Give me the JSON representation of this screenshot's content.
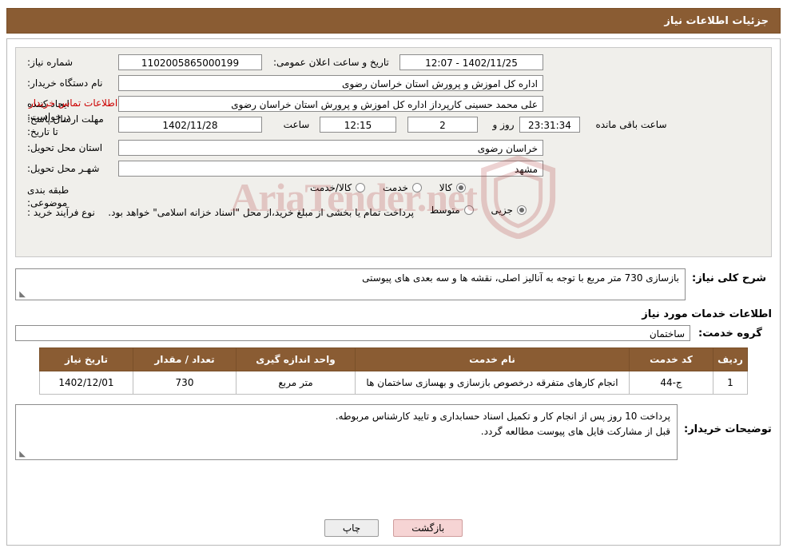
{
  "header": {
    "title": "جزئیات اطلاعات نیاز"
  },
  "info": {
    "need_number_label": "شماره نیاز:",
    "need_number_value": "1102005865000199",
    "public_announce_label": "تاریخ و ساعت اعلان عمومی:",
    "public_announce_value": "1402/11/25 - 12:07",
    "buyer_org_label": "نام دستگاه خریدار:",
    "buyer_org_value": "اداره کل اموزش و پرورش استان خراسان رضوی",
    "requester_label": "ایجاد کننده درخواست:",
    "requester_value": "علی محمد حسینی کارپرداز اداره کل اموزش و پرورش استان خراسان رضوی",
    "contact_link": "اطلاعات تماس خریدار",
    "deadline_label": "مهلت ارسال پاسخ: تا تاریخ:",
    "deadline_date": "1402/11/28",
    "deadline_hour_label": "ساعت",
    "deadline_hour": "12:15",
    "days_value": "2",
    "days_label": "روز و",
    "countdown_value": "23:31:34",
    "remaining_label": "ساعت باقی مانده",
    "province_label": "استان محل تحویل:",
    "province_value": "خراسان رضوی",
    "city_label": "شهـر محل تحویل:",
    "city_value": "مشهد",
    "category_label": "طبقه بندی موضوعی:",
    "category_options": [
      {
        "label": "کالا",
        "selected": true
      },
      {
        "label": "خدمت",
        "selected": false
      },
      {
        "label": "کالا/خدمت",
        "selected": false
      }
    ],
    "purchase_type_label": "نوع فرآیند خرید :",
    "purchase_type_options": [
      {
        "label": "جزیی",
        "selected": true
      },
      {
        "label": "متوسط",
        "selected": false
      }
    ],
    "purchase_note": "پرداخت تمام یا بخشی از مبلغ خرید،از محل \"اسناد خزانه اسلامی\" خواهد بود."
  },
  "watermark": {
    "text": "AriaTender.net"
  },
  "description": {
    "label": "شرح کلی نیاز:",
    "value": "بازسازی 730 متر مربع با توجه به آنالیز اصلی، نقشه ها و سه بعدی های پیوستی"
  },
  "services": {
    "section_title": "اطلاعات خدمات مورد نیاز",
    "group_label": "گروه خدمت:",
    "group_value": "ساختمان",
    "columns": [
      "ردیف",
      "کد خدمت",
      "نام خدمت",
      "واحد اندازه گیری",
      "تعداد / مقدار",
      "تاریخ نیاز"
    ],
    "rows": [
      {
        "row": "1",
        "code": "ج-44",
        "name": "انجام کارهای متفرقه درخصوص بازسازی و بهسازی ساختمان ها",
        "unit": "متر مربع",
        "qty": "730",
        "date": "1402/12/01"
      }
    ]
  },
  "notes": {
    "label": "توضیحات خریدار:",
    "line1": "پرداخت 10 روز پس از انجام کار و تکمیل اسناد حسابداری و تایید کارشناس مربوطه.",
    "line2": "قبل از مشارکت فایل های پیوست مطالعه گردد."
  },
  "footer": {
    "print_label": "چاپ",
    "back_label": "بازگشت"
  },
  "colors": {
    "brand": "#8a5c33",
    "link": "#cc0000",
    "watermark": "#b03535"
  }
}
